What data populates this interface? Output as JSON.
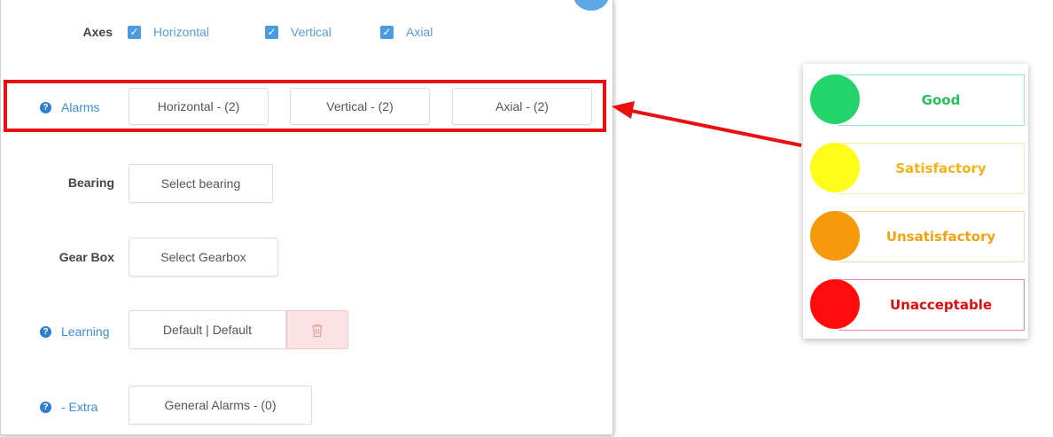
{
  "axes": {
    "label": "Axes",
    "options": [
      {
        "label": "Horizontal",
        "checked": true
      },
      {
        "label": "Vertical",
        "checked": true
      },
      {
        "label": "Axial",
        "checked": true
      }
    ]
  },
  "alarms": {
    "label": "Alarms",
    "buttons": [
      "Horizontal - (2)",
      "Vertical - (2)",
      "Axial - (2)"
    ]
  },
  "bearing": {
    "label": "Bearing",
    "button": "Select bearing"
  },
  "gearbox": {
    "label": "Gear Box",
    "button": "Select Gearbox"
  },
  "learning": {
    "label": "Learning",
    "button": "Default | Default",
    "delete_icon": "trash-icon"
  },
  "extra": {
    "label": "- Extra",
    "button": "General Alarms - (0)"
  },
  "legend": {
    "items": [
      {
        "label": "Good",
        "color": "#22d46a",
        "text_color": "#22c05a",
        "border": "#9fe3d6"
      },
      {
        "label": "Satisfactory",
        "color": "#fdfc1a",
        "text_color": "#f0b419",
        "border": "#f3efb4"
      },
      {
        "label": "Unsatisfactory",
        "color": "#f59a0c",
        "text_color": "#f3a30e",
        "border": "#f3dba8"
      },
      {
        "label": "Unacceptable",
        "color": "#ff0c0c",
        "text_color": "#e30b0b",
        "border": "#ea8a8a"
      }
    ]
  },
  "colors": {
    "highlight": "#e81010",
    "accent": "#4a9be0"
  }
}
